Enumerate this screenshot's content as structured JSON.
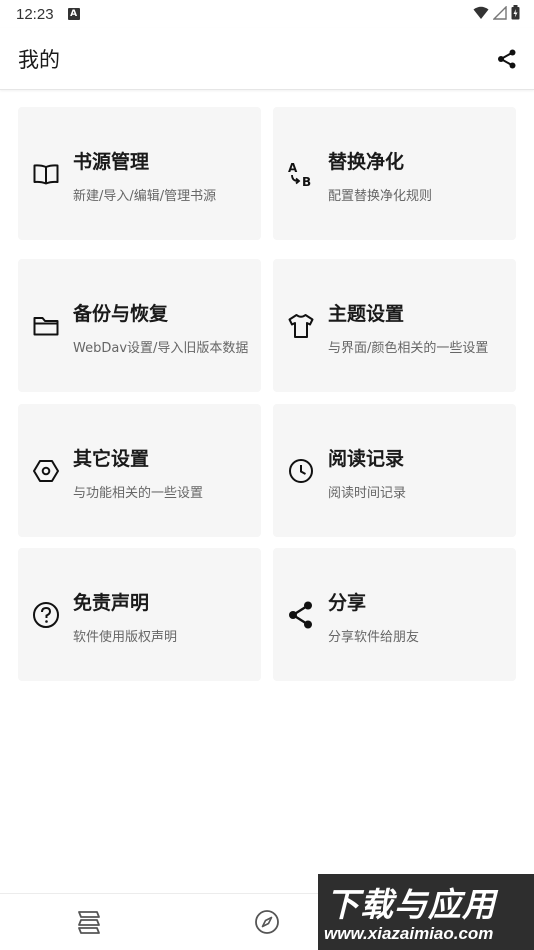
{
  "status": {
    "time": "12:23",
    "notification_glyph": "A"
  },
  "header": {
    "title": "我的",
    "share_icon": "share-icon"
  },
  "cards": [
    {
      "title": "书源管理",
      "subtitle": "新建/导入/编辑/管理书源",
      "icon": "book-open-icon"
    },
    {
      "title": "替换净化",
      "subtitle": "配置替换净化规则",
      "icon": "a-to-b-icon"
    },
    {
      "title": "备份与恢复",
      "subtitle": "WebDav设置/导入旧版本数据",
      "icon": "folder-icon"
    },
    {
      "title": "主题设置",
      "subtitle": "与界面/颜色相关的一些设置",
      "icon": "shirt-icon"
    },
    {
      "title": "其它设置",
      "subtitle": "与功能相关的一些设置",
      "icon": "settings-hex-icon"
    },
    {
      "title": "阅读记录",
      "subtitle": "阅读时间记录",
      "icon": "clock-icon"
    },
    {
      "title": "免责声明",
      "subtitle": "软件使用版权声明",
      "icon": "help-circle-icon"
    },
    {
      "title": "分享",
      "subtitle": "分享软件给朋友",
      "icon": "share-icon"
    }
  ],
  "bottom_nav": [
    {
      "icon": "bookshelf-icon"
    },
    {
      "icon": "compass-icon"
    },
    {
      "icon": "person-icon"
    }
  ],
  "watermark": {
    "main": "下载与应用",
    "sub": "www.xiazaimiao.com"
  },
  "colors": {
    "card_bg": "#f6f6f6",
    "text_primary": "#1a1a1a",
    "text_secondary": "#666666"
  }
}
